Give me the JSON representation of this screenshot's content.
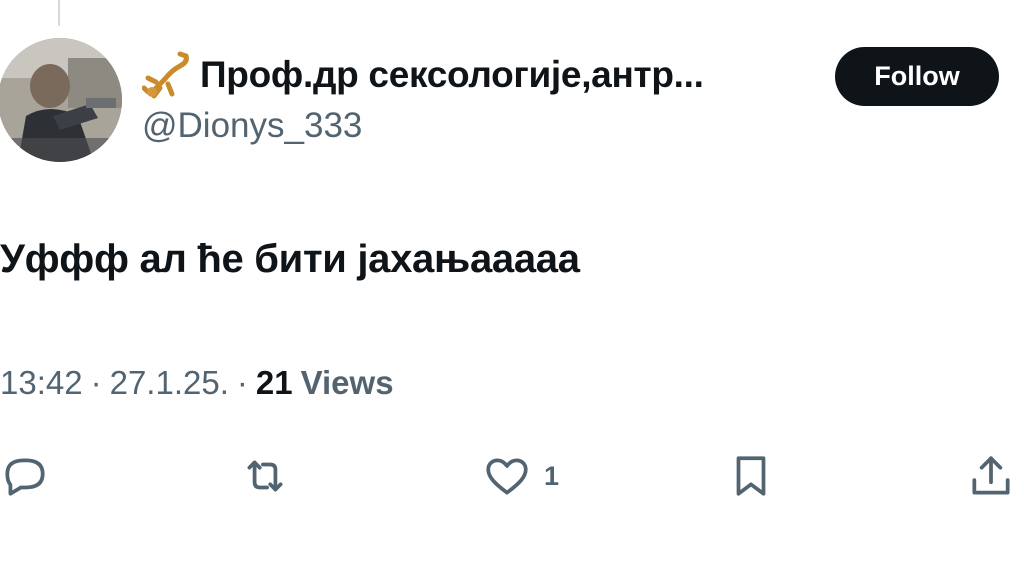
{
  "tweet": {
    "author": {
      "display_name": "Проф.др сексологије,антр...",
      "handle": "@Dionys_333"
    },
    "follow_label": "Follow",
    "text": "Уффф ал ће бити јахањааааа",
    "time": "13:42",
    "date": "27.1.25.",
    "separator": "·",
    "views_count": "21",
    "views_label": "Views",
    "actions": {
      "like_count": "1"
    }
  },
  "colors": {
    "text_primary": "#0f1419",
    "text_secondary": "#536471",
    "button_bg": "#0f1419",
    "button_text": "#ffffff"
  },
  "icons": [
    "scorpion-emoji",
    "reply-icon",
    "retweet-icon",
    "like-icon",
    "bookmark-icon",
    "share-icon"
  ]
}
